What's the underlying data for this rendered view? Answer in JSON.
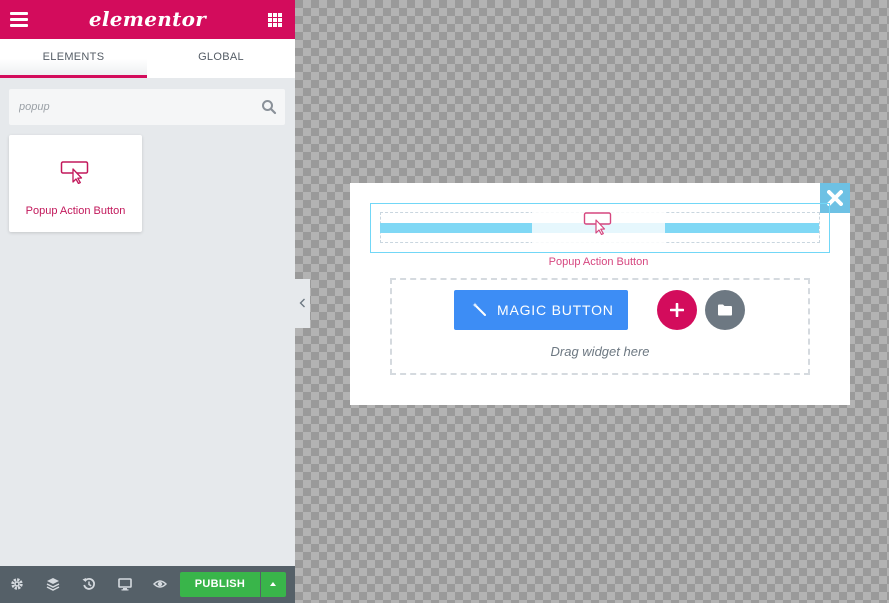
{
  "header": {
    "logo_text": "elementor",
    "brand_color": "#d30c5c",
    "menu_icon": "hamburger-icon",
    "widgets_icon": "grid-icon"
  },
  "tabs": {
    "elements": "ELEMENTS",
    "global": "GLOBAL",
    "active": "elements"
  },
  "search": {
    "value": "",
    "placeholder": "popup",
    "icon": "search-icon"
  },
  "widgets": [
    {
      "label": "Popup Action Button",
      "icon": "popup-action-button-icon"
    }
  ],
  "footer": {
    "icons": [
      "settings-icon",
      "navigator-icon",
      "history-icon",
      "responsive-icon",
      "preview-icon"
    ],
    "publish_label": "PUBLISH",
    "publish_color": "#39b54a"
  },
  "canvas": {
    "dragging_widget_label": "Popup Action Button",
    "magic_button_label": "MAGIC BUTTON",
    "magic_button_color": "#3d8df5",
    "drag_hint": "Drag widget here",
    "close_color": "#6ec1e4"
  }
}
